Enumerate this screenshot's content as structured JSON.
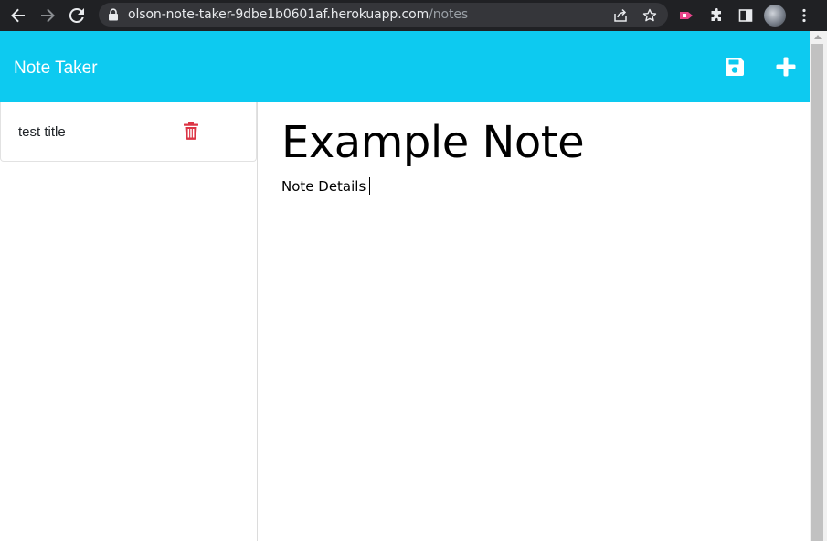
{
  "browser": {
    "url_host": "olson-note-taker-9dbe1b0601af.herokuapp.com",
    "url_path": "/notes",
    "icons": [
      "back-arrow-icon",
      "forward-arrow-icon",
      "reload-icon",
      "lock-icon",
      "share-icon",
      "star-icon",
      "extension-icon",
      "puzzle-icon",
      "sidepanel-icon",
      "profile-avatar",
      "kebab-menu-icon"
    ]
  },
  "header": {
    "brand": "Note Taker",
    "background_color": "#0dcaf0",
    "save_icon": "floppy-disk-icon",
    "new_icon": "plus-icon"
  },
  "sidebar": {
    "notes": [
      {
        "title": "test title",
        "delete_icon": "trash-icon",
        "delete_color": "#dc3545"
      }
    ]
  },
  "editor": {
    "title": "Example Note",
    "body": "Note Details"
  }
}
